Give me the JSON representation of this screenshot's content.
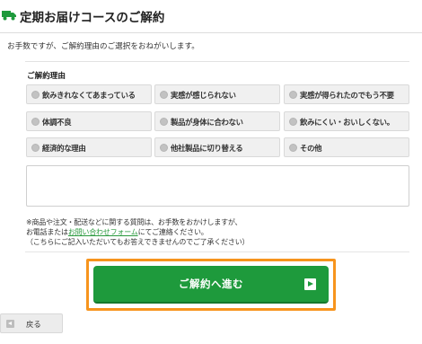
{
  "header": {
    "title": "定期お届けコースのご解約",
    "icon": "truck-icon",
    "accent_color": "#1e9a3c"
  },
  "intro": "お手数ですが、ご解約理由のご選択をおねがいします。",
  "reasons": {
    "heading": "ご解約理由",
    "options": [
      "飲みきれなくてあまっている",
      "実感が感じられない",
      "実感が得られたのでもう不要",
      "体調不良",
      "製品が身体に合わない",
      "飲みにくい・おいしくない。",
      "経済的な理由",
      "他社製品に切り替える",
      "その他"
    ]
  },
  "comment": {
    "value": "",
    "placeholder": ""
  },
  "notes": {
    "line1": "※商品や注文・配送などに関する質問は、お手数をおかけしますが、",
    "line2_prefix": "お電話または",
    "line2_link": "お問い合わせフォーム",
    "line2_suffix": "にてご連絡ください。",
    "line3": "（こちらにご記入いただいてもお答えできませんのでご了承ください）"
  },
  "submit": {
    "label": "ご解約へ進む",
    "icon": "play-icon",
    "color": "#1e9a3c",
    "highlight_color": "#f7941d"
  },
  "back": {
    "label": "戻る",
    "icon": "back-arrow-icon"
  }
}
